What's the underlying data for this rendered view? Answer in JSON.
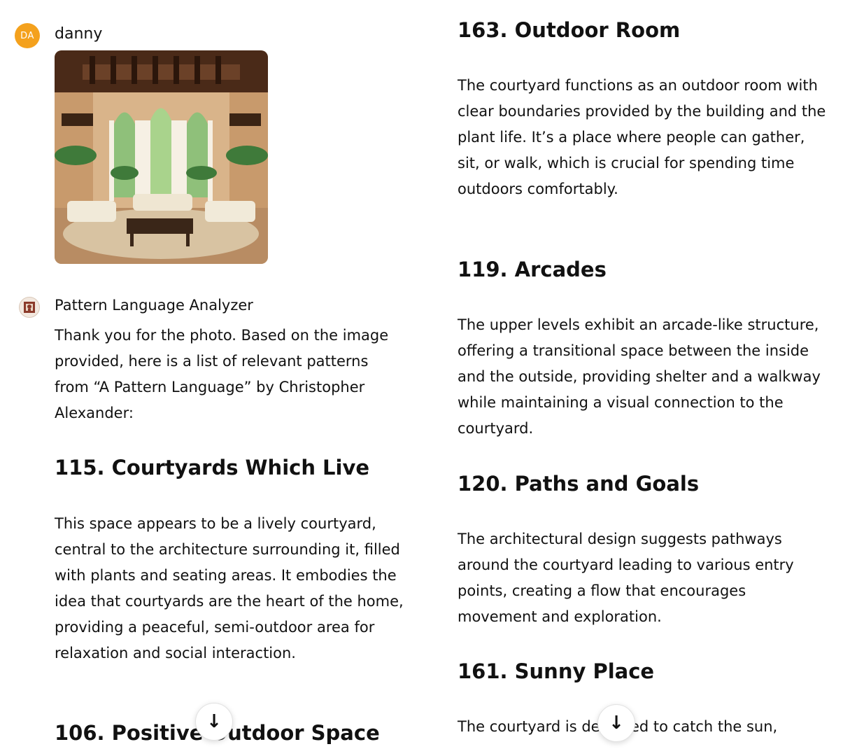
{
  "left": {
    "user": {
      "initials": "DA",
      "name": "danny",
      "avatar_color": "#f4a11d"
    },
    "bot": {
      "name": "Pattern Language Analyzer",
      "intro": "Thank you for the photo. Based on the image provided, here is a list of relevant patterns from “A Pattern Language” by Christopher Alexander:"
    },
    "sections": [
      {
        "heading": "115. Courtyards Which Live",
        "body": "This space appears to be a lively courtyard, central to the architecture surrounding it, filled with plants and seating areas. It embodies the idea that courtyards are the heart of the home, providing a peaceful, semi-outdoor area for relaxation and social interaction."
      },
      {
        "heading": "106. Positive Outdoor Space",
        "body": ""
      }
    ],
    "scroll_down_icon": "↓"
  },
  "right": {
    "sections": [
      {
        "heading": "163. Outdoor Room",
        "body": "The courtyard functions as an outdoor room with clear boundaries provided by the building and the plant life. It’s a place where people can gather, sit, or walk, which is crucial for spending time outdoors comfortably."
      },
      {
        "heading": "119. Arcades",
        "body": "The upper levels exhibit an arcade-like structure, offering a transitional space between the inside and the outside, providing shelter and a walkway while maintaining a visual connection to the courtyard."
      },
      {
        "heading": "120. Paths and Goals",
        "body": "The architectural design suggests pathways around the courtyard leading to various entry points, creating a flow that encourages movement and exploration."
      },
      {
        "heading": "161. Sunny Place",
        "body": "The courtyard is designed to catch the sun,"
      }
    ],
    "scroll_down_icon": "↓"
  }
}
